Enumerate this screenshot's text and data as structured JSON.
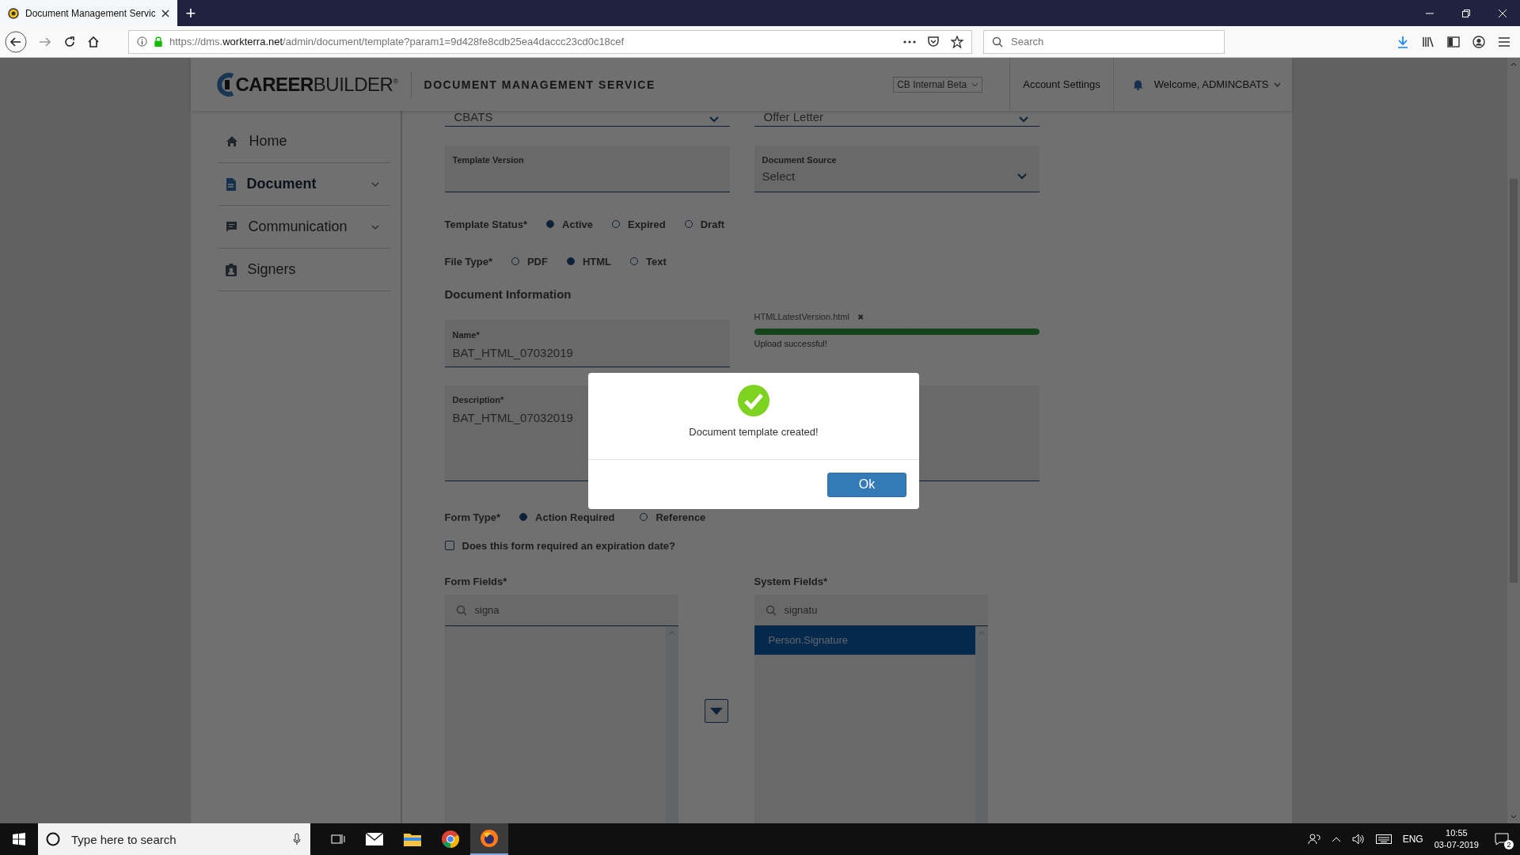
{
  "browser": {
    "tab_title": "Document Management Servic",
    "new_tab": "+",
    "url": "https://dms.**workterra.net**/admin/document/template?param1=9d428fe8cdb25ea4daccc23cd0c18cef",
    "search": {
      "placeholder": "Search"
    }
  },
  "header": {
    "logo": "**CAREER**BUILDER$^{®}$",
    "service_title": "DOCUMENT MANAGEMENT SERVICE",
    "environment": "CB Internal Beta",
    "account_settings": "Account Settings",
    "welcome": "Welcome, ADMINCBATS"
  },
  "sidebar": {
    "items": [
      {
        "label": "Home",
        "selected": false,
        "expandable": false,
        "kind": "home"
      },
      {
        "label": "Document",
        "selected": true,
        "expandable": true,
        "kind": "document"
      },
      {
        "label": "Communication",
        "selected": false,
        "expandable": true,
        "kind": "chat"
      },
      {
        "label": "Signers",
        "selected": false,
        "expandable": false,
        "kind": "badge"
      }
    ]
  },
  "form": {
    "top_selects": [
      {
        "value": "CBATS"
      },
      {
        "value": "Offer Letter"
      }
    ],
    "template_version": {
      "label": "Template Version"
    },
    "document_source": {
      "label": "Document Source",
      "value": "Select"
    },
    "template_status": {
      "label": "Template Status*",
      "options": [
        {
          "label": "Active",
          "selected": true
        },
        {
          "label": "Expired",
          "selected": false
        },
        {
          "label": "Draft",
          "selected": false
        }
      ]
    },
    "file_type": {
      "label": "File Type*",
      "options": [
        {
          "label": "PDF",
          "selected": false
        },
        {
          "label": "HTML",
          "selected": true
        },
        {
          "label": "Text",
          "selected": false
        }
      ]
    },
    "section_title": "Document Information",
    "name": {
      "label": "Name*",
      "value": "BAT_HTML_07032019"
    },
    "upload": {
      "file_name": "HTMLLatestVersion.html",
      "remove": "✖",
      "level": 1,
      "status": "Upload successful!"
    },
    "description": {
      "label": "Description*",
      "value": "BAT_HTML_07032019"
    },
    "form_type": {
      "label": "Form Type*",
      "options": [
        {
          "label": "Action Required",
          "selected": true
        },
        {
          "label": "Reference",
          "selected": false
        }
      ]
    },
    "expiration": {
      "label": "Does this form required an expiration date?",
      "checked": false
    },
    "form_fields": {
      "label": "Form Fields*",
      "search_value": "signa"
    },
    "system_fields": {
      "label": "System Fields*",
      "search_value": "signatu",
      "items": [
        {
          "label": "Person.Signature",
          "selected": true
        }
      ]
    }
  },
  "modal": {
    "message": "Document template created!",
    "ok": "Ok"
  },
  "taskbar": {
    "search_placeholder": "Type here to search",
    "language": "ENG",
    "time": "10:55",
    "date": "03-07-2019",
    "notifications": "2"
  }
}
